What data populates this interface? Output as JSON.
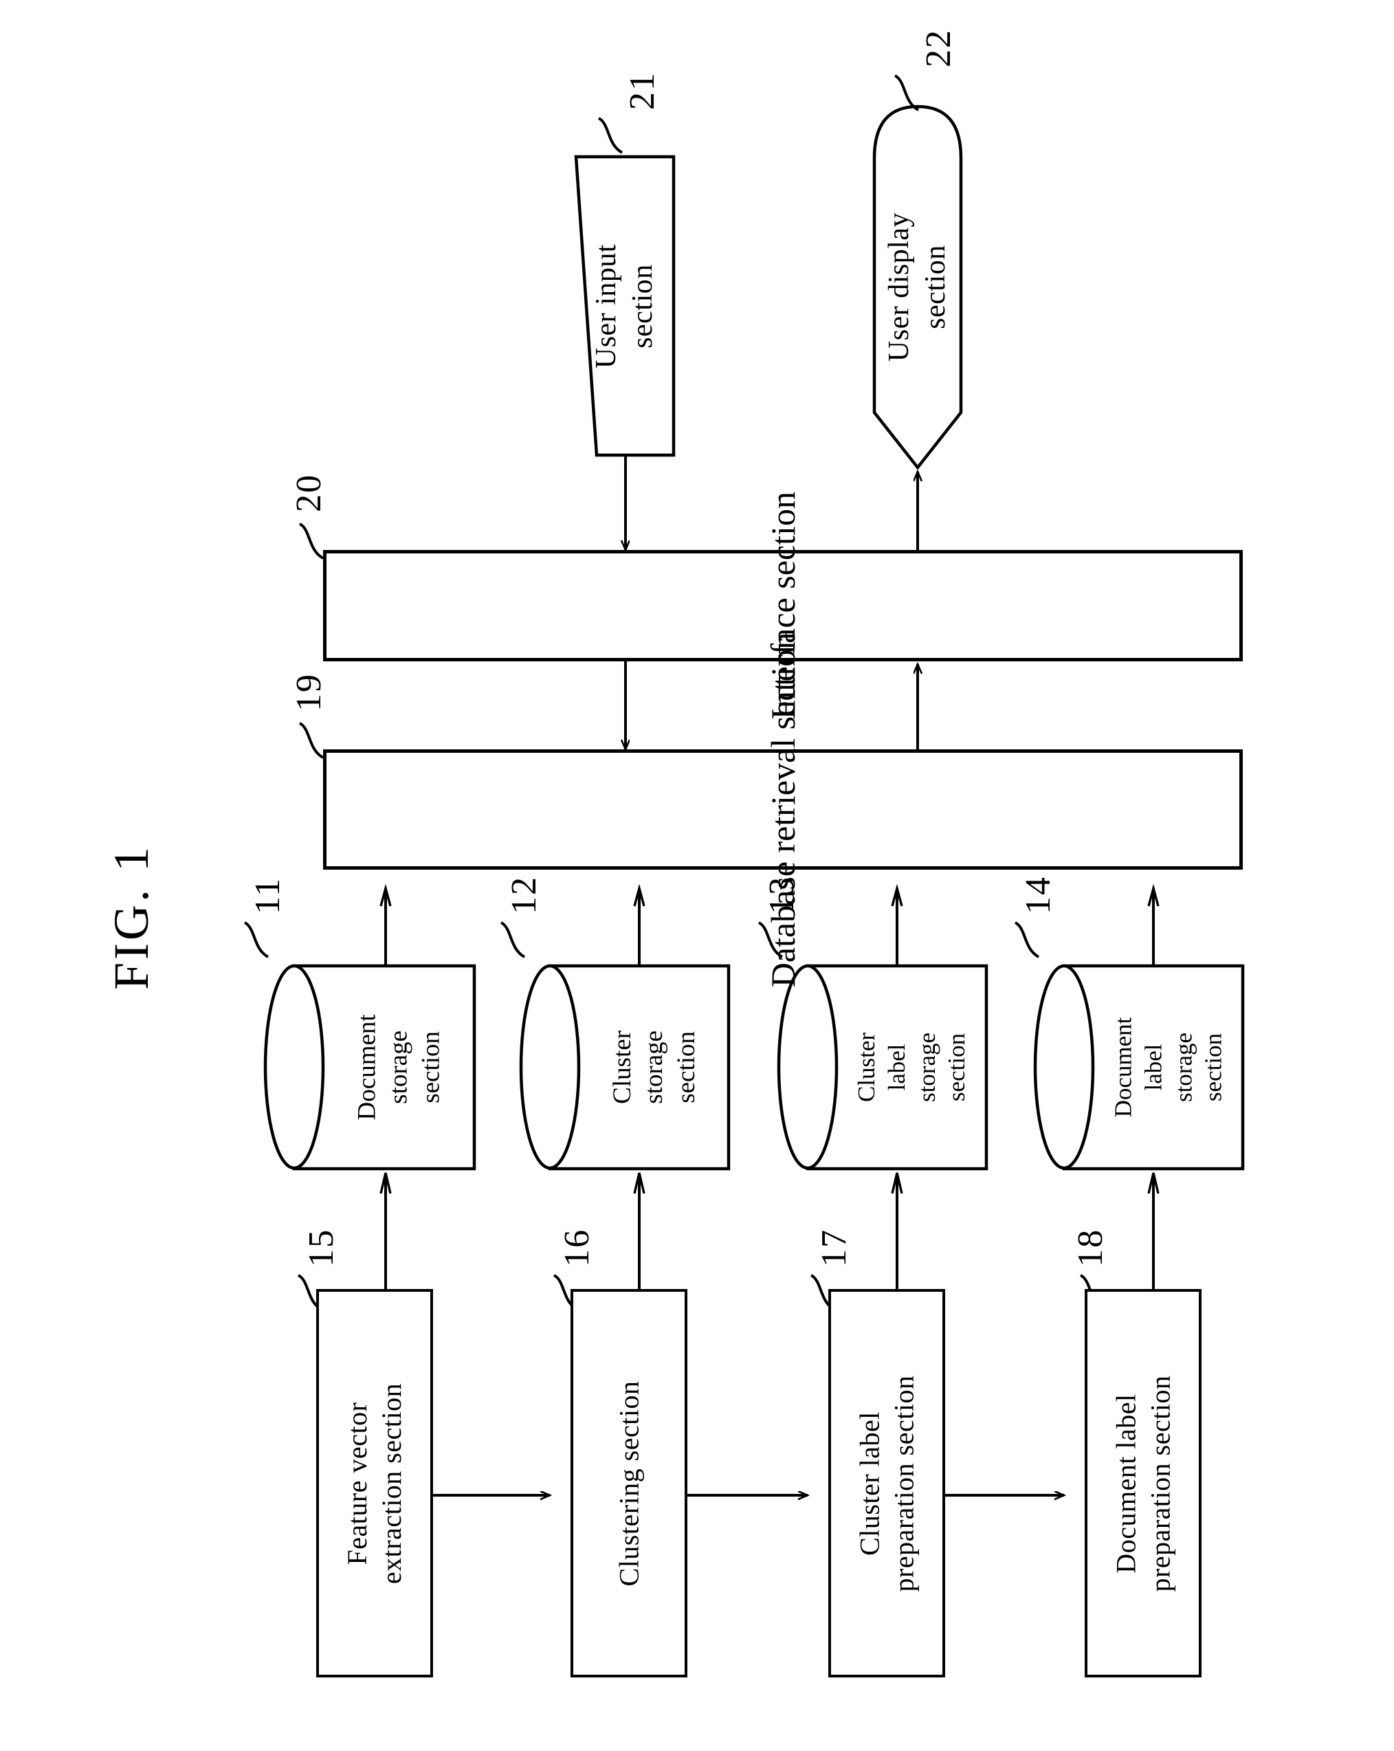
{
  "figure": {
    "label": "FIG. 1"
  },
  "nodes": {
    "user_input": {
      "ref": "21",
      "text": "User input\nsection"
    },
    "user_display": {
      "ref": "22",
      "text": "User display\nsection"
    },
    "interface": {
      "ref": "20",
      "text": "Interface section"
    },
    "database_retrieval": {
      "ref": "19",
      "text": "Database retrieval section"
    },
    "document_storage": {
      "ref": "11",
      "text": "Document\nstorage\nsection"
    },
    "cluster_storage": {
      "ref": "12",
      "text": "Cluster\nstorage\nsection"
    },
    "cluster_label_storage": {
      "ref": "13",
      "text": "Cluster\nlabel\nstorage\nsection"
    },
    "document_label_storage": {
      "ref": "14",
      "text": "Document\nlabel\nstorage\nsection"
    },
    "feature_vector_extraction": {
      "ref": "15",
      "text": "Feature vector\nextraction section"
    },
    "clustering": {
      "ref": "16",
      "text": "Clustering section"
    },
    "cluster_label_preparation": {
      "ref": "17",
      "text": "Cluster label\npreparation section"
    },
    "document_label_preparation": {
      "ref": "18",
      "text": "Document label\npreparation section"
    }
  },
  "style": {
    "stroke": "#000000",
    "background": "#ffffff"
  }
}
